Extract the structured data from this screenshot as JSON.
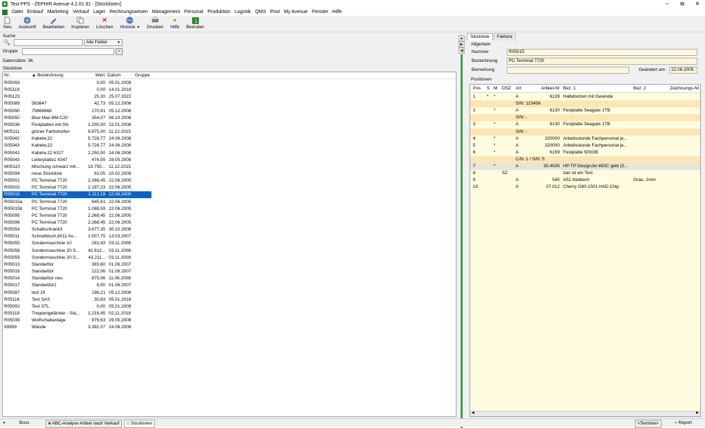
{
  "window": {
    "title": "Test PPS - ZEPHIR Avenue 4.2.01.91 - [Stücklisten]"
  },
  "menu": [
    "Datei",
    "Einkauf",
    "Marketing",
    "Verkauf",
    "Lager",
    "Rechnungswesen",
    "Management",
    "Personal",
    "Produktion",
    "Logistik",
    "QMS",
    "Post",
    "My Avenue",
    "Fenster",
    "Hilfe"
  ],
  "toolbar": {
    "neu": "Neu",
    "auskunft": "Auskunft",
    "bearbeiten": "Bearbeiten",
    "kopieren": "Kopieren",
    "loeschen": "Löschen",
    "historie": "Historie",
    "drucken": "Drucken",
    "hilfe": "Hilfe",
    "beenden": "Beenden"
  },
  "search": {
    "section_label": "Suche",
    "search_value": "",
    "field_select": "Alle Felder",
    "group_label": "Gruppe",
    "group_value": "",
    "records_label": "Datensätze:",
    "records_count": "36"
  },
  "list": {
    "section_label": "Stückliste",
    "columns": {
      "nr": "Nr.",
      "bez": "▲ Bezeichnung",
      "wert": "Wert",
      "datum": "Datum",
      "gruppe": "Gruppe"
    },
    "rows": [
      {
        "nr": "R05093",
        "bez": "",
        "wert": "0,00",
        "datum": "05.01.2009"
      },
      {
        "nr": "R05119",
        "bez": "",
        "wert": "0,00",
        "datum": "14.01.2019"
      },
      {
        "nr": "R05123",
        "bez": "",
        "wert": "25,30",
        "datum": "25.07.2022"
      },
      {
        "nr": "R05089",
        "bez": "563847",
        "wert": "42,73",
        "datum": "05.12.2008"
      },
      {
        "nr": "R05090",
        "bez": "75866868",
        "wert": "170,91",
        "datum": "05.12.2008"
      },
      {
        "nr": "R05050",
        "bez": "Blue Max BM-C20",
        "wert": "354,07",
        "datum": "06.10.2008"
      },
      {
        "nr": "R05036",
        "bez": "Festplatten mit SN",
        "wert": "1.200,00",
        "datum": "22.01.2008"
      },
      {
        "nr": "M05111",
        "bez": "grüner Farbstreifen",
        "wert": "9.875,00",
        "datum": "11.12.2015"
      },
      {
        "nr": "S05042",
        "bez": "Kabelw.22",
        "wert": "5.728,77",
        "datum": "24.06.2008"
      },
      {
        "nr": "S05043",
        "bez": "Kabelw.22",
        "wert": "5.728,77",
        "datum": "24.06.2008"
      },
      {
        "nr": "R05041",
        "bez": "Kabelw.22 6317",
        "wert": "2.250,00",
        "datum": "24.06.2008"
      },
      {
        "nr": "R05043",
        "bez": "Leiterplatte1 6347",
        "wert": "474,55",
        "datum": "29.05.2008"
      },
      {
        "nr": "M05110",
        "bez": "Mischung schwarz mit...",
        "wert": "19.750...",
        "datum": "11.12.2015"
      },
      {
        "nr": "R05094",
        "bez": "neue Stückliste",
        "wert": "91,05",
        "datum": "10.02.2009"
      },
      {
        "nr": "R05001",
        "bez": "PC Terminal 7720",
        "wert": "2.268,45",
        "datum": "22.06.2005"
      },
      {
        "nr": "R05002",
        "bez": "PC Terminal 7720",
        "wert": "2.197,23",
        "datum": "22.06.2005"
      },
      {
        "nr": "R05015",
        "bez": "PC Terminal 7720",
        "wert": "1.112,19",
        "datum": "22.06.2005"
      },
      {
        "nr": "R05015a",
        "bez": "PC Terminal 7720",
        "wert": "645,61",
        "datum": "22.06.2005"
      },
      {
        "nr": "R05015b",
        "bez": "PC Terminal 7720",
        "wert": "1.088,59",
        "datum": "22.06.2005"
      },
      {
        "nr": "R05095",
        "bez": "PC Terminal 7720",
        "wert": "2.268,45",
        "datum": "22.06.2005"
      },
      {
        "nr": "R05096",
        "bez": "PC Terminal 7720",
        "wert": "2.268,45",
        "datum": "22.06.2005"
      },
      {
        "nr": "R05054",
        "bez": "Schaltschrank3",
        "wert": "3.677,35",
        "datum": "30.10.2008"
      },
      {
        "nr": "R05011",
        "bez": "Schreibtisch,6011-ho...",
        "wert": "1.507,75",
        "datum": "13.03.2007"
      },
      {
        "nr": "R05055",
        "bez": "Sondermaschine 10",
        "wert": "281,43",
        "datum": "03.11.2008"
      },
      {
        "nr": "R05058",
        "bez": "Sondermaschine 20 S...",
        "wert": "42.912...",
        "datum": "03.11.2008"
      },
      {
        "nr": "R05059",
        "bez": "Sondermaschine 20 S...",
        "wert": "43.211...",
        "datum": "03.11.2008"
      },
      {
        "nr": "R05013",
        "bez": "Standarttür",
        "wert": "383,60",
        "datum": "01.06.2007"
      },
      {
        "nr": "R05016",
        "bez": "Standarttür",
        "wert": "222,06",
        "datum": "01.06.2007"
      },
      {
        "nr": "R05014",
        "bez": "Standarttür  neu",
        "wert": "875,06",
        "datum": "11.06.2008"
      },
      {
        "nr": "R05017",
        "bez": "Standarttür2",
        "wert": "8,00",
        "datum": "01.06.2007"
      },
      {
        "nr": "R05087",
        "bez": "test 19",
        "wert": "196,21",
        "datum": "05.12.2008"
      },
      {
        "nr": "R05116",
        "bez": "Test SAS",
        "wert": "30,83",
        "datum": "05.01.2016"
      },
      {
        "nr": "R05092",
        "bez": "Test STL",
        "wert": "0,00",
        "datum": "05.01.2009"
      },
      {
        "nr": "R05118",
        "bez": "Treppengeländer - Sta...",
        "wert": "1.216,45",
        "datum": "02.11.2018"
      },
      {
        "nr": "R05039",
        "bez": "Wolfschaltanlage",
        "wert": "876,63",
        "datum": "29.05.2008"
      },
      {
        "nr": "99999",
        "bez": "Wände",
        "wert": "3.392,07",
        "datum": "24.06.2008"
      }
    ]
  },
  "detail": {
    "tabs": [
      "Stückliste",
      "Faktura"
    ],
    "allgemein_label": "Allgemein",
    "nummer_label": "Nummer",
    "nummer": "R05015",
    "bez_label": "Bezeichnung",
    "bez": "PC Terminal 7720",
    "bem_label": "Bemerkung",
    "bem": "",
    "geaendert_label": "Geändert am",
    "geaendert": "22.06.2005",
    "positionen_label": "Positionen",
    "pcols": {
      "pos": "Pos",
      "s": "S",
      "m": "M",
      "dsz": "DSZ",
      "art": "Art",
      "artnr": "Artikel-Nr",
      "bez1": "Bez. 1",
      "bez2": "Bez. 2",
      "zeich": "Zeichnungs-Nr"
    },
    "prows": [
      {
        "pos": "1",
        "s": "*",
        "m": "*",
        "dsz": "",
        "art": "A",
        "artnr": "6139",
        "bez1": "Haltebolzen mit Gewinde",
        "bez2": "",
        "sub": false
      },
      {
        "sub": true,
        "text": "S/N: 123456"
      },
      {
        "pos": "2",
        "s": "",
        "m": "*",
        "dsz": "",
        "art": "A",
        "artnr": "6130",
        "bez1": "Festplatte Seagate 1TB",
        "bez2": "",
        "sub": false
      },
      {
        "sub": true,
        "text": "S/N: -"
      },
      {
        "pos": "3",
        "s": "",
        "m": "*",
        "dsz": "",
        "art": "A",
        "artnr": "6130",
        "bez1": "Festplatte Seagate 1TB",
        "bez2": "",
        "sub": false
      },
      {
        "sub": true,
        "text": "S/N: -"
      },
      {
        "pos": "4",
        "s": "",
        "m": "*",
        "dsz": "",
        "art": "A",
        "artnr": "320000",
        "bez1": "Arbeitsstunde Fachpersonal je...",
        "bez2": "",
        "sub": false
      },
      {
        "pos": "5",
        "s": "",
        "m": "*",
        "dsz": "",
        "art": "A",
        "artnr": "320000",
        "bez1": "Arbeitsstunde Fachpersonal je...",
        "bez2": "",
        "sub": false
      },
      {
        "pos": "6",
        "s": "",
        "m": "*",
        "dsz": "",
        "art": "A",
        "artnr": "6159",
        "bez1": "Festplatte 500GB",
        "bez2": "",
        "sub": false
      },
      {
        "sub": true,
        "text": "C/N: 1 / S/N: 5"
      },
      {
        "pos": "7",
        "s": "",
        "m": "*",
        "dsz": "",
        "art": "A",
        "artnr": "30.4026",
        "bez1": "HP TP DesignJet 650C gelb (5...",
        "bez2": "",
        "sub": false,
        "sel": true
      },
      {
        "pos": "8",
        "s": "",
        "m": "",
        "dsz": "SZ",
        "art": "",
        "artnr": "",
        "bez1": "das ist ein Text",
        "bez2": "",
        "sub": false
      },
      {
        "pos": "9",
        "s": "",
        "m": "",
        "dsz": "",
        "art": "A",
        "artnr": "545",
        "bez1": "A51 Alublech",
        "bez2": "Grau, 2mm",
        "sub": false
      },
      {
        "pos": "10",
        "s": "",
        "m": "",
        "dsz": "",
        "art": "A",
        "artnr": "07.012",
        "bez1": "Cherry G80-1501 HAD Chip",
        "bez2": "",
        "sub": false
      }
    ]
  },
  "status": {
    "user": "Boss",
    "tab1": "ABC-Analyse Artikel nach Verkauf",
    "tab2": "Stücklisten",
    "termine": "<Termine>",
    "report": "Report"
  },
  "colors": {
    "selection": "#0a64c8",
    "splitter": "#3aa03a",
    "sub_row": "#fde5b4",
    "yellow_field": "#fff8d8"
  }
}
